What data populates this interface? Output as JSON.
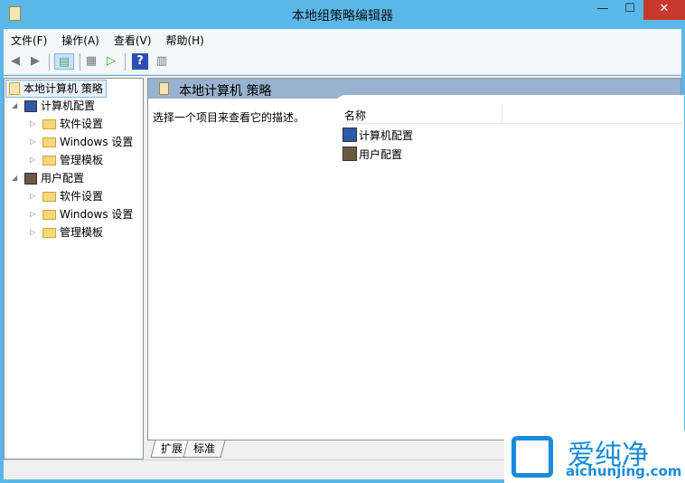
{
  "window": {
    "title": "本地组策略编辑器",
    "minimize": "—",
    "maximize": "☐",
    "close": "✕"
  },
  "menu": [
    "文件(F)",
    "操作(A)",
    "查看(V)",
    "帮助(H)"
  ],
  "tree": {
    "root": "本地计算机 策略",
    "computer": "计算机配置",
    "user": "用户配置",
    "children": [
      "软件设置",
      "Windows 设置",
      "管理模板"
    ]
  },
  "right": {
    "title": "本地计算机 策略",
    "description": "选择一个项目来查看它的描述。",
    "column": "名称",
    "items": [
      "计算机配置",
      "用户配置"
    ]
  },
  "tabs": [
    "扩展",
    "标准"
  ],
  "watermark": {
    "cn": "爱纯净",
    "en": "aichunjing.com"
  }
}
